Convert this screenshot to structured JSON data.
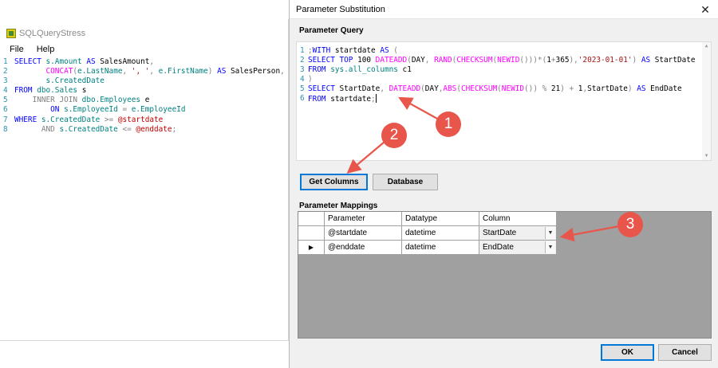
{
  "left_app": {
    "title": "SQLQueryStress",
    "menu": [
      "File",
      "Help"
    ],
    "lines": [
      {
        "n": "1",
        "tokens": [
          [
            "kw",
            "SELECT "
          ],
          [
            "id",
            "s.Amount "
          ],
          [
            "kw",
            "AS "
          ],
          [
            "",
            "SalesAmount"
          ],
          [
            "gr",
            ","
          ]
        ]
      },
      {
        "n": "2",
        "tokens": [
          [
            "",
            "       "
          ],
          [
            "fn",
            "CONCAT"
          ],
          [
            "gr",
            "("
          ],
          [
            "id",
            "e.LastName"
          ],
          [
            "gr",
            ", "
          ],
          [
            "str",
            "', '"
          ],
          [
            "gr",
            ", "
          ],
          [
            "id",
            "e.FirstName"
          ],
          [
            "gr",
            ") "
          ],
          [
            "kw",
            "AS "
          ],
          [
            "",
            "SalesPerson"
          ],
          [
            "gr",
            ","
          ]
        ]
      },
      {
        "n": "3",
        "tokens": [
          [
            "",
            "       "
          ],
          [
            "id",
            "s.CreatedDate"
          ]
        ]
      },
      {
        "n": "4",
        "tokens": [
          [
            "kw",
            "FROM "
          ],
          [
            "id",
            "dbo.Sales "
          ],
          [
            "",
            "s"
          ]
        ]
      },
      {
        "n": "5",
        "tokens": [
          [
            "",
            "    "
          ],
          [
            "gr",
            "INNER JOIN "
          ],
          [
            "id",
            "dbo.Employees "
          ],
          [
            "",
            "e"
          ]
        ]
      },
      {
        "n": "6",
        "tokens": [
          [
            "",
            "        "
          ],
          [
            "kw",
            "ON "
          ],
          [
            "id",
            "s.EmployeeId "
          ],
          [
            "gr",
            "= "
          ],
          [
            "id",
            "e.EmployeeId"
          ]
        ]
      },
      {
        "n": "7",
        "tokens": [
          [
            "kw",
            "WHERE "
          ],
          [
            "id",
            "s.CreatedDate "
          ],
          [
            "gr",
            ">= "
          ],
          [
            "var",
            "@startdate"
          ]
        ]
      },
      {
        "n": "8",
        "tokens": [
          [
            "",
            "      "
          ],
          [
            "gr",
            "AND "
          ],
          [
            "id",
            "s.CreatedDate "
          ],
          [
            "gr",
            "<= "
          ],
          [
            "var",
            "@enddate"
          ],
          [
            "gr",
            ";"
          ]
        ]
      }
    ]
  },
  "dialog": {
    "title": "Parameter Substitution",
    "close_glyph": "✕",
    "parameter_query_label": "Parameter Query",
    "query_lines": [
      {
        "n": "1",
        "tokens": [
          [
            "gr",
            ";"
          ],
          [
            "kw",
            "WITH "
          ],
          [
            "",
            "startdate "
          ],
          [
            "kw",
            "AS "
          ],
          [
            "gr",
            "("
          ]
        ]
      },
      {
        "n": "2",
        "tokens": [
          [
            "kw",
            "SELECT TOP "
          ],
          [
            "",
            "100 "
          ],
          [
            "fn",
            "DATEADD"
          ],
          [
            "gr",
            "("
          ],
          [
            "",
            "DAY"
          ],
          [
            "gr",
            ", "
          ],
          [
            "fn",
            "RAND"
          ],
          [
            "gr",
            "("
          ],
          [
            "fn",
            "CHECKSUM"
          ],
          [
            "gr",
            "("
          ],
          [
            "fn",
            "NEWID"
          ],
          [
            "gr",
            "()))*("
          ],
          [
            "",
            "1"
          ],
          [
            "gr",
            "+"
          ],
          [
            "",
            "365"
          ],
          [
            "gr",
            "),"
          ],
          [
            "str",
            "'2023-01-01'"
          ],
          [
            "gr",
            ") "
          ],
          [
            "kw",
            "AS "
          ],
          [
            "",
            "StartDate"
          ]
        ]
      },
      {
        "n": "3",
        "tokens": [
          [
            "kw",
            "FROM "
          ],
          [
            "id",
            "sys.all_columns "
          ],
          [
            "",
            "c1"
          ]
        ]
      },
      {
        "n": "4",
        "tokens": [
          [
            "gr",
            ")"
          ]
        ]
      },
      {
        "n": "5",
        "tokens": [
          [
            "kw",
            "SELECT "
          ],
          [
            "",
            "StartDate"
          ],
          [
            "gr",
            ", "
          ],
          [
            "fn",
            "DATEADD"
          ],
          [
            "gr",
            "("
          ],
          [
            "",
            "DAY"
          ],
          [
            "gr",
            ","
          ],
          [
            "fn",
            "ABS"
          ],
          [
            "gr",
            "("
          ],
          [
            "fn",
            "CHECKSUM"
          ],
          [
            "gr",
            "("
          ],
          [
            "fn",
            "NEWID"
          ],
          [
            "gr",
            "()) % "
          ],
          [
            "",
            "21"
          ],
          [
            "gr",
            ") + "
          ],
          [
            "",
            "1"
          ],
          [
            "gr",
            ","
          ],
          [
            "",
            "StartDate"
          ],
          [
            "gr",
            ") "
          ],
          [
            "kw",
            "AS "
          ],
          [
            "",
            "EndDate"
          ]
        ]
      },
      {
        "n": "6",
        "tokens": [
          [
            "kw",
            "FROM "
          ],
          [
            "",
            "startdate"
          ],
          [
            "gr",
            ";"
          ]
        ]
      }
    ],
    "buttons": {
      "get_columns": "Get Columns",
      "database": "Database",
      "ok": "OK",
      "cancel": "Cancel"
    },
    "parameter_mappings_label": "Parameter Mappings",
    "grid": {
      "headers": [
        "Parameter",
        "Datatype",
        "Column"
      ],
      "rows": [
        {
          "parameter": "@startdate",
          "datatype": "datetime",
          "column": "StartDate",
          "pointer": ""
        },
        {
          "parameter": "@enddate",
          "datatype": "datetime",
          "column": "EndDate",
          "pointer": "▶"
        }
      ]
    }
  },
  "annotations": {
    "badges": [
      "1",
      "2",
      "3"
    ],
    "color": "#e8564b"
  }
}
